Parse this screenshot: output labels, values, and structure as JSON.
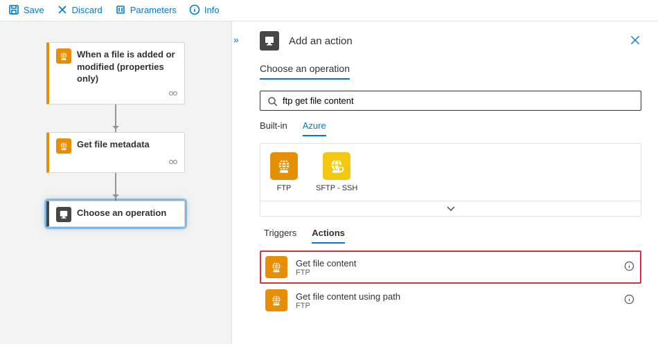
{
  "toolbar": {
    "save": "Save",
    "discard": "Discard",
    "parameters": "Parameters",
    "info": "Info"
  },
  "canvas": {
    "trigger": {
      "title": "When a file is added or modified (properties only)"
    },
    "action1": {
      "title": "Get file metadata"
    },
    "placeholder": {
      "title": "Choose an operation"
    }
  },
  "panel": {
    "title": "Add an action",
    "subhead": "Choose an operation",
    "search_value": "ftp get file content",
    "scope_tabs": {
      "builtin": "Built-in",
      "azure": "Azure"
    },
    "connectors": {
      "ftp": "FTP",
      "sftp": "SFTP - SSH"
    },
    "mode_tabs": {
      "triggers": "Triggers",
      "actions": "Actions"
    },
    "ops": [
      {
        "title": "Get file content",
        "sub": "FTP"
      },
      {
        "title": "Get file content using path",
        "sub": "FTP"
      }
    ]
  }
}
